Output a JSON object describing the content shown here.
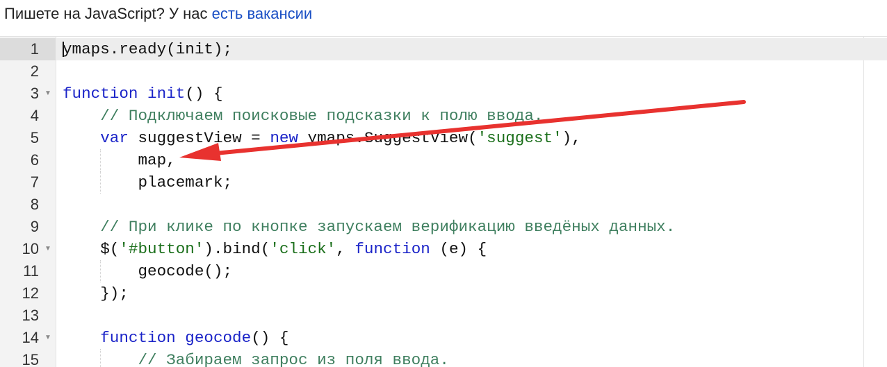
{
  "banner": {
    "prefix": "Пишете на JavaScript? У нас ",
    "link": "есть вакансии"
  },
  "editor": {
    "lines": [
      {
        "n": "1",
        "fold": false,
        "guides": [],
        "tokens": [
          {
            "t": "ymaps.ready(init);"
          }
        ]
      },
      {
        "n": "2",
        "fold": false,
        "guides": [],
        "tokens": []
      },
      {
        "n": "3",
        "fold": true,
        "guides": [],
        "tokens": [
          {
            "t": "function",
            "c": "kw"
          },
          {
            "t": " "
          },
          {
            "t": "init",
            "c": "fn"
          },
          {
            "t": "() {"
          }
        ]
      },
      {
        "n": "4",
        "fold": false,
        "guides": [],
        "tokens": [
          {
            "t": "    "
          },
          {
            "t": "// Подключаем поисковые подсказки к полю ввода.",
            "c": "cm"
          }
        ]
      },
      {
        "n": "5",
        "fold": false,
        "guides": [],
        "tokens": [
          {
            "t": "    "
          },
          {
            "t": "var",
            "c": "kw"
          },
          {
            "t": " suggestView = "
          },
          {
            "t": "new",
            "c": "kw"
          },
          {
            "t": " ymaps.SuggestView("
          },
          {
            "t": "'suggest'",
            "c": "st"
          },
          {
            "t": "),"
          }
        ]
      },
      {
        "n": "6",
        "fold": false,
        "guides": [
          4
        ],
        "tokens": [
          {
            "t": "        map,"
          }
        ]
      },
      {
        "n": "7",
        "fold": false,
        "guides": [
          4
        ],
        "tokens": [
          {
            "t": "        placemark;"
          }
        ]
      },
      {
        "n": "8",
        "fold": false,
        "guides": [],
        "tokens": []
      },
      {
        "n": "9",
        "fold": false,
        "guides": [],
        "tokens": [
          {
            "t": "    "
          },
          {
            "t": "// При клике по кнопке запускаем верификацию введёных данных.",
            "c": "cm"
          }
        ]
      },
      {
        "n": "10",
        "fold": true,
        "guides": [],
        "tokens": [
          {
            "t": "    $("
          },
          {
            "t": "'#button'",
            "c": "st"
          },
          {
            "t": ").bind("
          },
          {
            "t": "'click'",
            "c": "st"
          },
          {
            "t": ", "
          },
          {
            "t": "function",
            "c": "kw"
          },
          {
            "t": " (e) {"
          }
        ]
      },
      {
        "n": "11",
        "fold": false,
        "guides": [
          4
        ],
        "tokens": [
          {
            "t": "        geocode();"
          }
        ]
      },
      {
        "n": "12",
        "fold": false,
        "guides": [],
        "tokens": [
          {
            "t": "    });"
          }
        ]
      },
      {
        "n": "13",
        "fold": false,
        "guides": [],
        "tokens": []
      },
      {
        "n": "14",
        "fold": true,
        "guides": [],
        "tokens": [
          {
            "t": "    "
          },
          {
            "t": "function",
            "c": "kw"
          },
          {
            "t": " "
          },
          {
            "t": "geocode",
            "c": "fn"
          },
          {
            "t": "() {"
          }
        ]
      },
      {
        "n": "15",
        "fold": false,
        "guides": [
          4
        ],
        "tokens": [
          {
            "t": "        "
          },
          {
            "t": "// Забираем запрос из поля ввода.",
            "c": "cm"
          }
        ]
      }
    ]
  },
  "colors": {
    "arrow": "#e8322f",
    "keyword": "#1a23c8",
    "comment": "#3f7f5f",
    "string": "#1b6f1b",
    "link": "#1a4fc4"
  }
}
